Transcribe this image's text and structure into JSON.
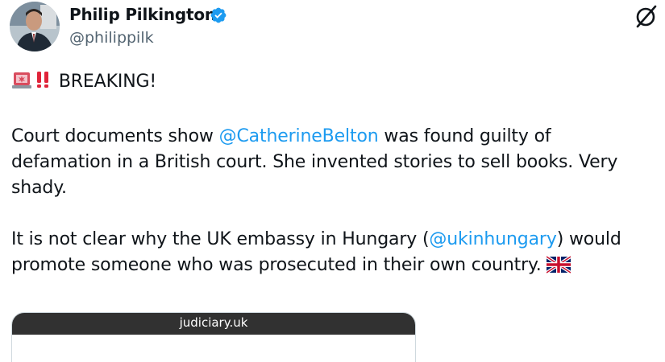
{
  "author": {
    "display_name": "Philip Pilkington",
    "handle": "@philippilk",
    "verified": true
  },
  "icons": {
    "verified": "verified-badge-icon",
    "menu": "grok-slash-icon",
    "alert": "police-light-emoji",
    "exclaim": "double-exclamation-emoji",
    "flag": "uk-flag-emoji"
  },
  "tweet": {
    "breaking": "BREAKING!",
    "p1_a": "Court documents show ",
    "p1_mention": "@CatherineBelton",
    "p1_b": " was found guilty of",
    "p1_line2": "defamation in a British court. She invented stories to sell books. Very",
    "p1_line3": "shady.",
    "p2_a": "It is not clear why the UK embassy in Hungary (",
    "p2_mention": "@ukinhungary",
    "p2_b": ") would",
    "p2_line2": "promote someone who was prosecuted in their own country. "
  },
  "card": {
    "domain": "judiciary.uk"
  },
  "colors": {
    "text": "#0f1419",
    "secondary": "#536471",
    "mention": "#1d9bf0",
    "verified": "#1d9bf0",
    "card_bar": "#313131"
  }
}
